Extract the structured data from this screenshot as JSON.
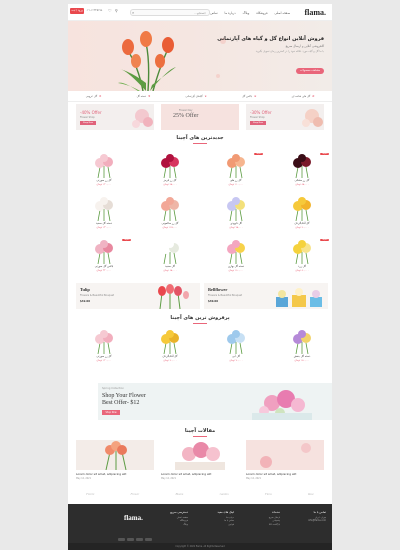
{
  "header": {
    "logo": "flama.",
    "nav": [
      "صفحه اصلی",
      "فروشگاه",
      "وبلاگ",
      "درباره ما",
      "تماس با ما"
    ],
    "search_placeholder": "جستجو...",
    "cta": "ورود / ثبت نام",
    "phone": "۰۲۱-۱۲۳۴۵۶۷۸"
  },
  "hero": {
    "title": "فروش آنلاین انواع گل و گیاه های آپارتمانی",
    "subtitle": "گلفروشی آنلاین و ارسال سریع",
    "desc": "با ما گل و گیاه مورد علاقه خود را در کمترین زمان تحویل بگیرید",
    "button": "مشاهده محصولات"
  },
  "categories": [
    "گل های شاخه ای",
    "باکس گل",
    "گیاهان آپارتمانی",
    "دسته گل",
    "گل عروس"
  ],
  "banners": [
    {
      "t1": "-40% Offer",
      "t2": "Flower Shop",
      "t3": "Shop Now"
    },
    {
      "t1": "25% Offer",
      "t2": "Flower Day",
      "t3": ""
    },
    {
      "t1": "-30% Offer",
      "t2": "Flower Shop",
      "t3": "Shop Now"
    }
  ],
  "sections": {
    "newest": "جدیدترین های آچینا",
    "popular": "پرفروش ترین های آچینا",
    "blog": "مقالات آچینا"
  },
  "products": [
    {
      "name": "گل رز صورتی",
      "price": "۱۲۰,۰۰۰ تومان",
      "tag": ""
    },
    {
      "name": "گل رز قرمز",
      "price": "۹۵,۰۰۰ تومان",
      "tag": ""
    },
    {
      "name": "گل رز هلو",
      "price": "۱۱۰,۰۰۰ تومان",
      "tag": "تخفیف"
    },
    {
      "name": "گل رز مشکی",
      "price": "۸۵,۰۰۰ تومان",
      "tag": "تخفیف"
    },
    {
      "name": "دسته گل سفید",
      "price": "۱۳۰,۰۰۰ تومان",
      "tag": ""
    },
    {
      "name": "گل رز سالمونی",
      "price": "۱۴۵,۰۰۰ تومان",
      "tag": ""
    },
    {
      "name": "گل داوودی",
      "price": "۷۵,۰۰۰ تومان",
      "tag": ""
    },
    {
      "name": "گل آفتابگردان",
      "price": "۹۰,۰۰۰ تومان",
      "tag": ""
    },
    {
      "name": "باکس گل صورتی",
      "price": "۲۲۰,۰۰۰ تومان",
      "tag": "تخفیف"
    },
    {
      "name": "گل سفید",
      "price": "۶۵,۰۰۰ تومان",
      "tag": ""
    },
    {
      "name": "دسته گل بهاری",
      "price": "۱۸۰,۰۰۰ تومان",
      "tag": ""
    },
    {
      "name": "گل زرد",
      "price": "۸۰,۰۰۰ تومان",
      "tag": "تخفیف"
    }
  ],
  "promos": [
    {
      "t1": "Tulip",
      "t2": "Flowers & Beautiful Bouquet",
      "t3": "$32.00"
    },
    {
      "t1": "Bellflower",
      "t2": "Flowers & Beautiful Bouquet",
      "t3": "$30.00"
    }
  ],
  "popular": [
    {
      "name": "گل رز صورتی",
      "price": "۱۲۰,۰۰۰ تومان"
    },
    {
      "name": "گل آفتابگردان",
      "price": "۹۰,۰۰۰ تومان"
    },
    {
      "name": "گل آبی",
      "price": "۷۰,۰۰۰ تومان"
    },
    {
      "name": "دسته گل بنفش",
      "price": "۱۵۰,۰۰۰ تومان"
    }
  ],
  "bigbanner": {
    "b1": "Spring Collection",
    "b2": "Shop Your Flower",
    "b3": "Best Offer- $12",
    "b4": "Shop Now"
  },
  "blog": [
    {
      "title": "Lorem dolor sit amet, adipiscing elit",
      "meta": "May 12, 2021"
    },
    {
      "title": "Lorem dolor sit amet, adipiscing elit",
      "meta": "May 12, 2021"
    },
    {
      "title": "Lorem dolor sit amet, adipiscing elit",
      "meta": "May 12, 2021"
    }
  ],
  "partners": [
    "Florist",
    "Flower",
    "Bloom",
    "Garden",
    "Flora",
    "Rose"
  ],
  "footer": {
    "logo": "flama.",
    "cols": [
      {
        "h": "دسترسی سریع",
        "links": [
          "صفحه اصلی",
          "فروشگاه",
          "وبلاگ"
        ]
      },
      {
        "h": "لینک های مفید",
        "links": [
          "درباره ما",
          "تماس با ما",
          "قوانین"
        ]
      },
      {
        "h": "خدمات",
        "links": [
          "ارسال سریع",
          "پشتیبانی",
          "بازگشت کالا"
        ]
      },
      {
        "h": "تماس با ما",
        "links": [
          "تهران، ایران",
          "info@flama.com"
        ]
      }
    ],
    "copyright": "Copyright © 2021 flama. All Rights Reserved"
  },
  "colors": {
    "accent": "#e9667a",
    "badge": "#e9484d",
    "footer": "#2d2d2d"
  }
}
